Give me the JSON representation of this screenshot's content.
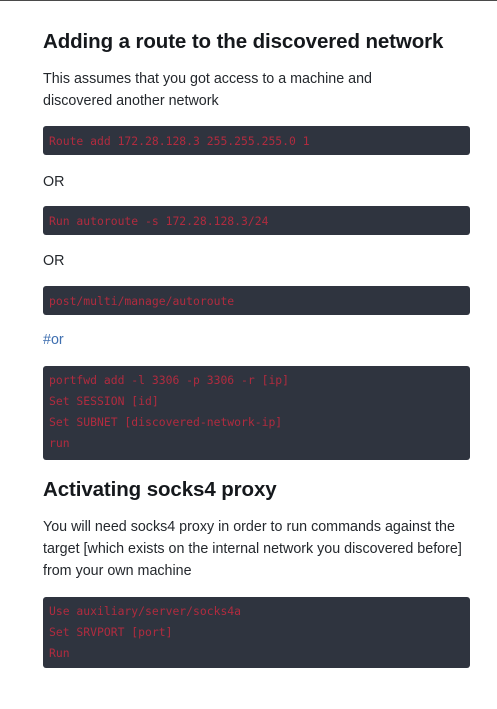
{
  "section1": {
    "heading": "Adding a route to the discovered network",
    "intro": "This assumes that you got access to a machine and discovered another network",
    "code1": [
      "Route add 172.28.128.3 255.255.255.0 1"
    ],
    "or1": "OR",
    "code2": [
      "Run autoroute -s 172.28.128.3/24"
    ],
    "or2": "OR",
    "code3": [
      "post/multi/manage/autoroute"
    ],
    "or_link": "#or",
    "code4": [
      "portfwd add -l 3306 -p 3306 -r [ip]",
      "Set SESSION [id]",
      "Set SUBNET [discovered-network-ip]",
      "run"
    ]
  },
  "section2": {
    "heading": "Activating socks4 proxy",
    "intro": "You will need socks4 proxy in order to run commands against the target [which exists on the internal network you discovered before] from your own machine",
    "code1": [
      "Use auxiliary/server/socks4a",
      "Set SRVPORT [port]",
      "Run"
    ]
  }
}
